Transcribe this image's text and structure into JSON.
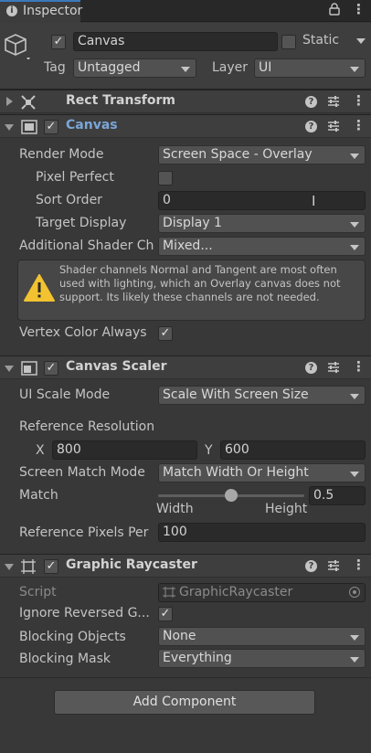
{
  "tab": {
    "label": "Inspector",
    "icon": "info-icon"
  },
  "gameobject": {
    "name": "Canvas",
    "active": true,
    "static_label": "Static",
    "static_checked": false,
    "tag_label": "Tag",
    "tag_value": "Untagged",
    "layer_label": "Layer",
    "layer_value": "UI"
  },
  "rect_transform": {
    "title": "Rect Transform",
    "expanded": false
  },
  "canvas": {
    "title": "Canvas",
    "enabled": true,
    "render_mode_label": "Render Mode",
    "render_mode_value": "Screen Space - Overlay",
    "pixel_perfect_label": "Pixel Perfect",
    "pixel_perfect": false,
    "sort_order_label": "Sort Order",
    "sort_order_value": "0",
    "target_display_label": "Target Display",
    "target_display_value": "Display 1",
    "shader_channels_label": "Additional Shader Ch",
    "shader_channels_value": "Mixed...",
    "warning_text": "Shader channels Normal and Tangent are most often used with lighting, which an Overlay canvas does not support. Its likely these channels are not needed.",
    "vertex_color_label": "Vertex Color Always",
    "vertex_color": true
  },
  "canvas_scaler": {
    "title": "Canvas Scaler",
    "enabled": true,
    "ui_scale_label": "UI Scale Mode",
    "ui_scale_value": "Scale With Screen Size",
    "ref_res_label": "Reference Resolution",
    "x_label": "X",
    "x_value": "800",
    "y_label": "Y",
    "y_value": "600",
    "screen_match_label": "Screen Match Mode",
    "screen_match_value": "Match Width Or Height",
    "match_label": "Match",
    "match_value": "0.5",
    "match_fraction": 0.5,
    "width_label": "Width",
    "height_label": "Height",
    "ref_pixels_label": "Reference Pixels Per",
    "ref_pixels_value": "100"
  },
  "graphic_raycaster": {
    "title": "Graphic Raycaster",
    "enabled": true,
    "script_label": "Script",
    "script_value": "GraphicRaycaster",
    "ignore_reversed_label": "Ignore Reversed G...",
    "ignore_reversed": true,
    "blocking_objects_label": "Blocking Objects",
    "blocking_objects_value": "None",
    "blocking_mask_label": "Blocking Mask",
    "blocking_mask_value": "Everything"
  },
  "add_component_label": "Add Component"
}
